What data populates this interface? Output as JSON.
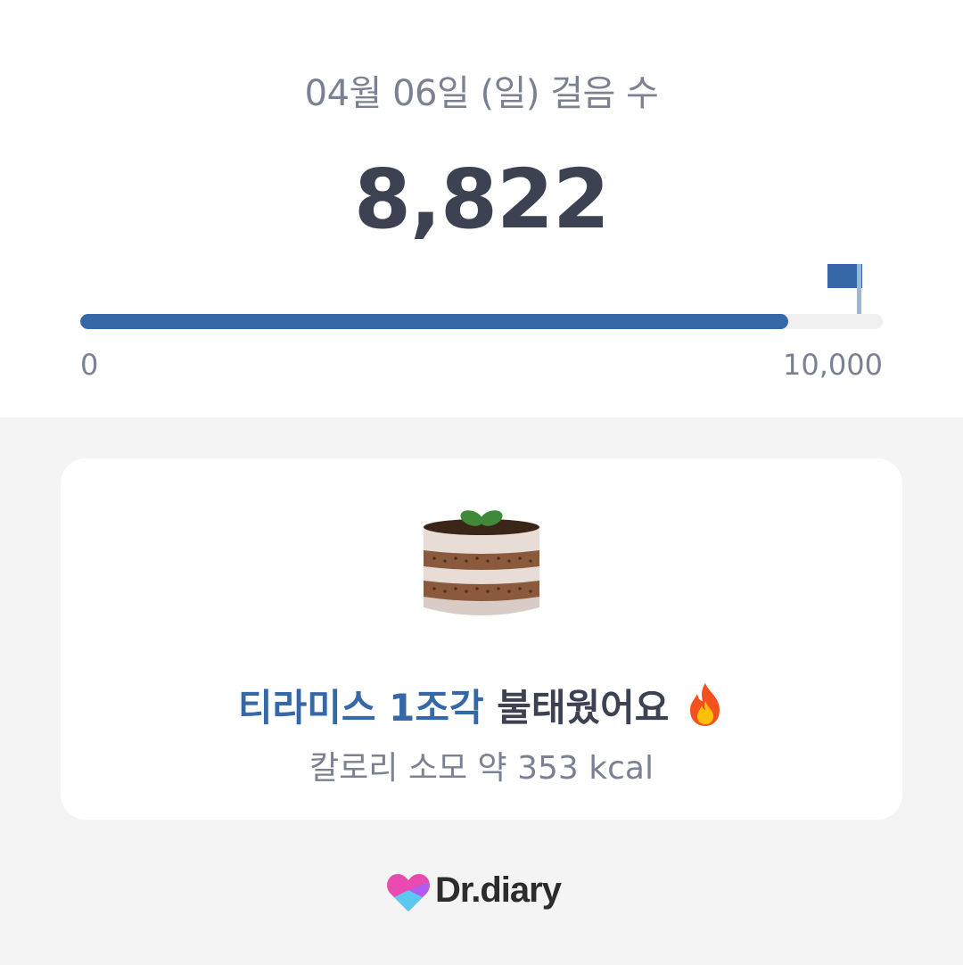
{
  "header": {
    "date_label": "04월 06일 (일) 걸음 수",
    "step_count": "8,822"
  },
  "progress": {
    "value": 8822,
    "goal": 10000,
    "fraction": 0.8822,
    "min_label": "0",
    "max_label": "10,000",
    "fill_color": "#3668a8"
  },
  "result": {
    "food_label": "티라미스 1조각",
    "burned_label": "불태웠어요",
    "calorie_text": "칼로리 소모 약 353 kcal",
    "food_icon": "tiramisu-cake-icon",
    "burn_icon": "fire-icon"
  },
  "brand": {
    "name": "Dr.diary",
    "logo_icon": "heart-logo-icon"
  }
}
